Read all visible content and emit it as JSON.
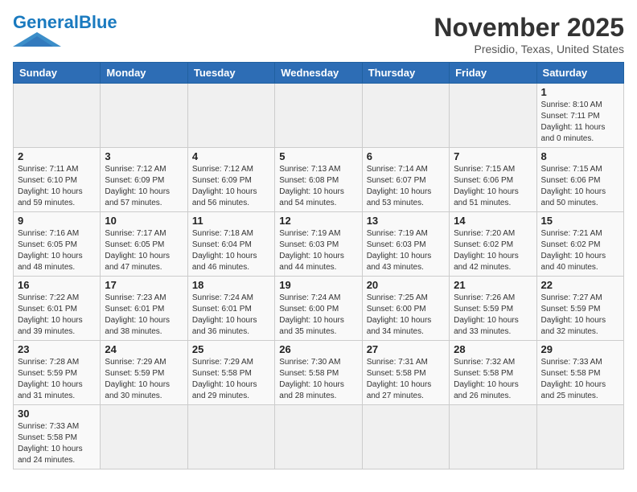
{
  "header": {
    "logo_general": "General",
    "logo_blue": "Blue",
    "month_title": "November 2025",
    "location": "Presidio, Texas, United States"
  },
  "weekdays": [
    "Sunday",
    "Monday",
    "Tuesday",
    "Wednesday",
    "Thursday",
    "Friday",
    "Saturday"
  ],
  "weeks": [
    [
      {
        "day": "",
        "info": ""
      },
      {
        "day": "",
        "info": ""
      },
      {
        "day": "",
        "info": ""
      },
      {
        "day": "",
        "info": ""
      },
      {
        "day": "",
        "info": ""
      },
      {
        "day": "",
        "info": ""
      },
      {
        "day": "1",
        "info": "Sunrise: 8:10 AM\nSunset: 7:11 PM\nDaylight: 11 hours\nand 0 minutes."
      }
    ],
    [
      {
        "day": "2",
        "info": "Sunrise: 7:11 AM\nSunset: 6:10 PM\nDaylight: 10 hours\nand 59 minutes."
      },
      {
        "day": "3",
        "info": "Sunrise: 7:12 AM\nSunset: 6:09 PM\nDaylight: 10 hours\nand 57 minutes."
      },
      {
        "day": "4",
        "info": "Sunrise: 7:12 AM\nSunset: 6:09 PM\nDaylight: 10 hours\nand 56 minutes."
      },
      {
        "day": "5",
        "info": "Sunrise: 7:13 AM\nSunset: 6:08 PM\nDaylight: 10 hours\nand 54 minutes."
      },
      {
        "day": "6",
        "info": "Sunrise: 7:14 AM\nSunset: 6:07 PM\nDaylight: 10 hours\nand 53 minutes."
      },
      {
        "day": "7",
        "info": "Sunrise: 7:15 AM\nSunset: 6:06 PM\nDaylight: 10 hours\nand 51 minutes."
      },
      {
        "day": "8",
        "info": "Sunrise: 7:15 AM\nSunset: 6:06 PM\nDaylight: 10 hours\nand 50 minutes."
      }
    ],
    [
      {
        "day": "9",
        "info": "Sunrise: 7:16 AM\nSunset: 6:05 PM\nDaylight: 10 hours\nand 48 minutes."
      },
      {
        "day": "10",
        "info": "Sunrise: 7:17 AM\nSunset: 6:05 PM\nDaylight: 10 hours\nand 47 minutes."
      },
      {
        "day": "11",
        "info": "Sunrise: 7:18 AM\nSunset: 6:04 PM\nDaylight: 10 hours\nand 46 minutes."
      },
      {
        "day": "12",
        "info": "Sunrise: 7:19 AM\nSunset: 6:03 PM\nDaylight: 10 hours\nand 44 minutes."
      },
      {
        "day": "13",
        "info": "Sunrise: 7:19 AM\nSunset: 6:03 PM\nDaylight: 10 hours\nand 43 minutes."
      },
      {
        "day": "14",
        "info": "Sunrise: 7:20 AM\nSunset: 6:02 PM\nDaylight: 10 hours\nand 42 minutes."
      },
      {
        "day": "15",
        "info": "Sunrise: 7:21 AM\nSunset: 6:02 PM\nDaylight: 10 hours\nand 40 minutes."
      }
    ],
    [
      {
        "day": "16",
        "info": "Sunrise: 7:22 AM\nSunset: 6:01 PM\nDaylight: 10 hours\nand 39 minutes."
      },
      {
        "day": "17",
        "info": "Sunrise: 7:23 AM\nSunset: 6:01 PM\nDaylight: 10 hours\nand 38 minutes."
      },
      {
        "day": "18",
        "info": "Sunrise: 7:24 AM\nSunset: 6:01 PM\nDaylight: 10 hours\nand 36 minutes."
      },
      {
        "day": "19",
        "info": "Sunrise: 7:24 AM\nSunset: 6:00 PM\nDaylight: 10 hours\nand 35 minutes."
      },
      {
        "day": "20",
        "info": "Sunrise: 7:25 AM\nSunset: 6:00 PM\nDaylight: 10 hours\nand 34 minutes."
      },
      {
        "day": "21",
        "info": "Sunrise: 7:26 AM\nSunset: 5:59 PM\nDaylight: 10 hours\nand 33 minutes."
      },
      {
        "day": "22",
        "info": "Sunrise: 7:27 AM\nSunset: 5:59 PM\nDaylight: 10 hours\nand 32 minutes."
      }
    ],
    [
      {
        "day": "23",
        "info": "Sunrise: 7:28 AM\nSunset: 5:59 PM\nDaylight: 10 hours\nand 31 minutes."
      },
      {
        "day": "24",
        "info": "Sunrise: 7:29 AM\nSunset: 5:59 PM\nDaylight: 10 hours\nand 30 minutes."
      },
      {
        "day": "25",
        "info": "Sunrise: 7:29 AM\nSunset: 5:58 PM\nDaylight: 10 hours\nand 29 minutes."
      },
      {
        "day": "26",
        "info": "Sunrise: 7:30 AM\nSunset: 5:58 PM\nDaylight: 10 hours\nand 28 minutes."
      },
      {
        "day": "27",
        "info": "Sunrise: 7:31 AM\nSunset: 5:58 PM\nDaylight: 10 hours\nand 27 minutes."
      },
      {
        "day": "28",
        "info": "Sunrise: 7:32 AM\nSunset: 5:58 PM\nDaylight: 10 hours\nand 26 minutes."
      },
      {
        "day": "29",
        "info": "Sunrise: 7:33 AM\nSunset: 5:58 PM\nDaylight: 10 hours\nand 25 minutes."
      }
    ],
    [
      {
        "day": "30",
        "info": "Sunrise: 7:33 AM\nSunset: 5:58 PM\nDaylight: 10 hours\nand 24 minutes."
      },
      {
        "day": "",
        "info": ""
      },
      {
        "day": "",
        "info": ""
      },
      {
        "day": "",
        "info": ""
      },
      {
        "day": "",
        "info": ""
      },
      {
        "day": "",
        "info": ""
      },
      {
        "day": "",
        "info": ""
      }
    ]
  ]
}
